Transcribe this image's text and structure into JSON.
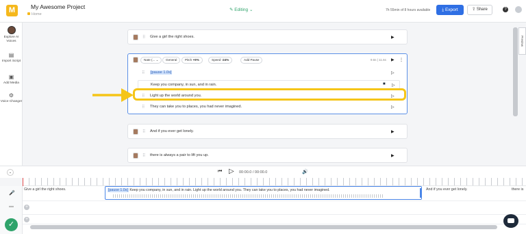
{
  "header": {
    "project_title": "My Awesome Project",
    "breadcrumb": "Home",
    "editing_label": "Editing",
    "usage_text": "7h 55min of 8 hours available",
    "export_label": "Export",
    "share_label": "Share",
    "help_label": "?"
  },
  "sidebar": {
    "items": [
      {
        "label": "Explore AI Voices",
        "icon": "voice-avatar"
      },
      {
        "label": "Import Script",
        "icon": "import-icon"
      },
      {
        "label": "Add Media",
        "icon": "media-icon"
      },
      {
        "label": "Voice Changer",
        "icon": "voice-changer-icon"
      }
    ]
  },
  "blocks": {
    "b1_text": "Give a girl the right shoes.",
    "active": {
      "voice_name": "Nate (...",
      "style": "General",
      "pitch_label": "Pitch",
      "pitch_value": "+9%",
      "speed_label": "Speed",
      "speed_value": "-24%",
      "add_pause": "Add Pause",
      "duration": "9.6s | 11.6s",
      "lines": [
        "[pause 1.0s]",
        "Keep you company, in sun, and in rain.",
        "Light up the world around you.",
        "They can take you to places, you had never imagined."
      ]
    },
    "b3_text": "And if you ever get lonely.",
    "b4_text": "there is always a pair to lift you up."
  },
  "preview_tab": "Preview",
  "player": {
    "timecode": "00:00.0 / 00:00.0"
  },
  "timeline": {
    "seg1": "Give a girl the right shoes.",
    "seg_pause": "[pause 1.0s]",
    "seg2": " Keep you company, in sun, and in rain. Light up the world around you. They can take you to places, you had never imagined.",
    "seg3": "And if you ever get lonely.",
    "seg4": "there is"
  },
  "colors": {
    "accent": "#2f6fe4",
    "highlight": "#f5c518",
    "success": "#2fa36b",
    "logo": "#f5b81c"
  }
}
